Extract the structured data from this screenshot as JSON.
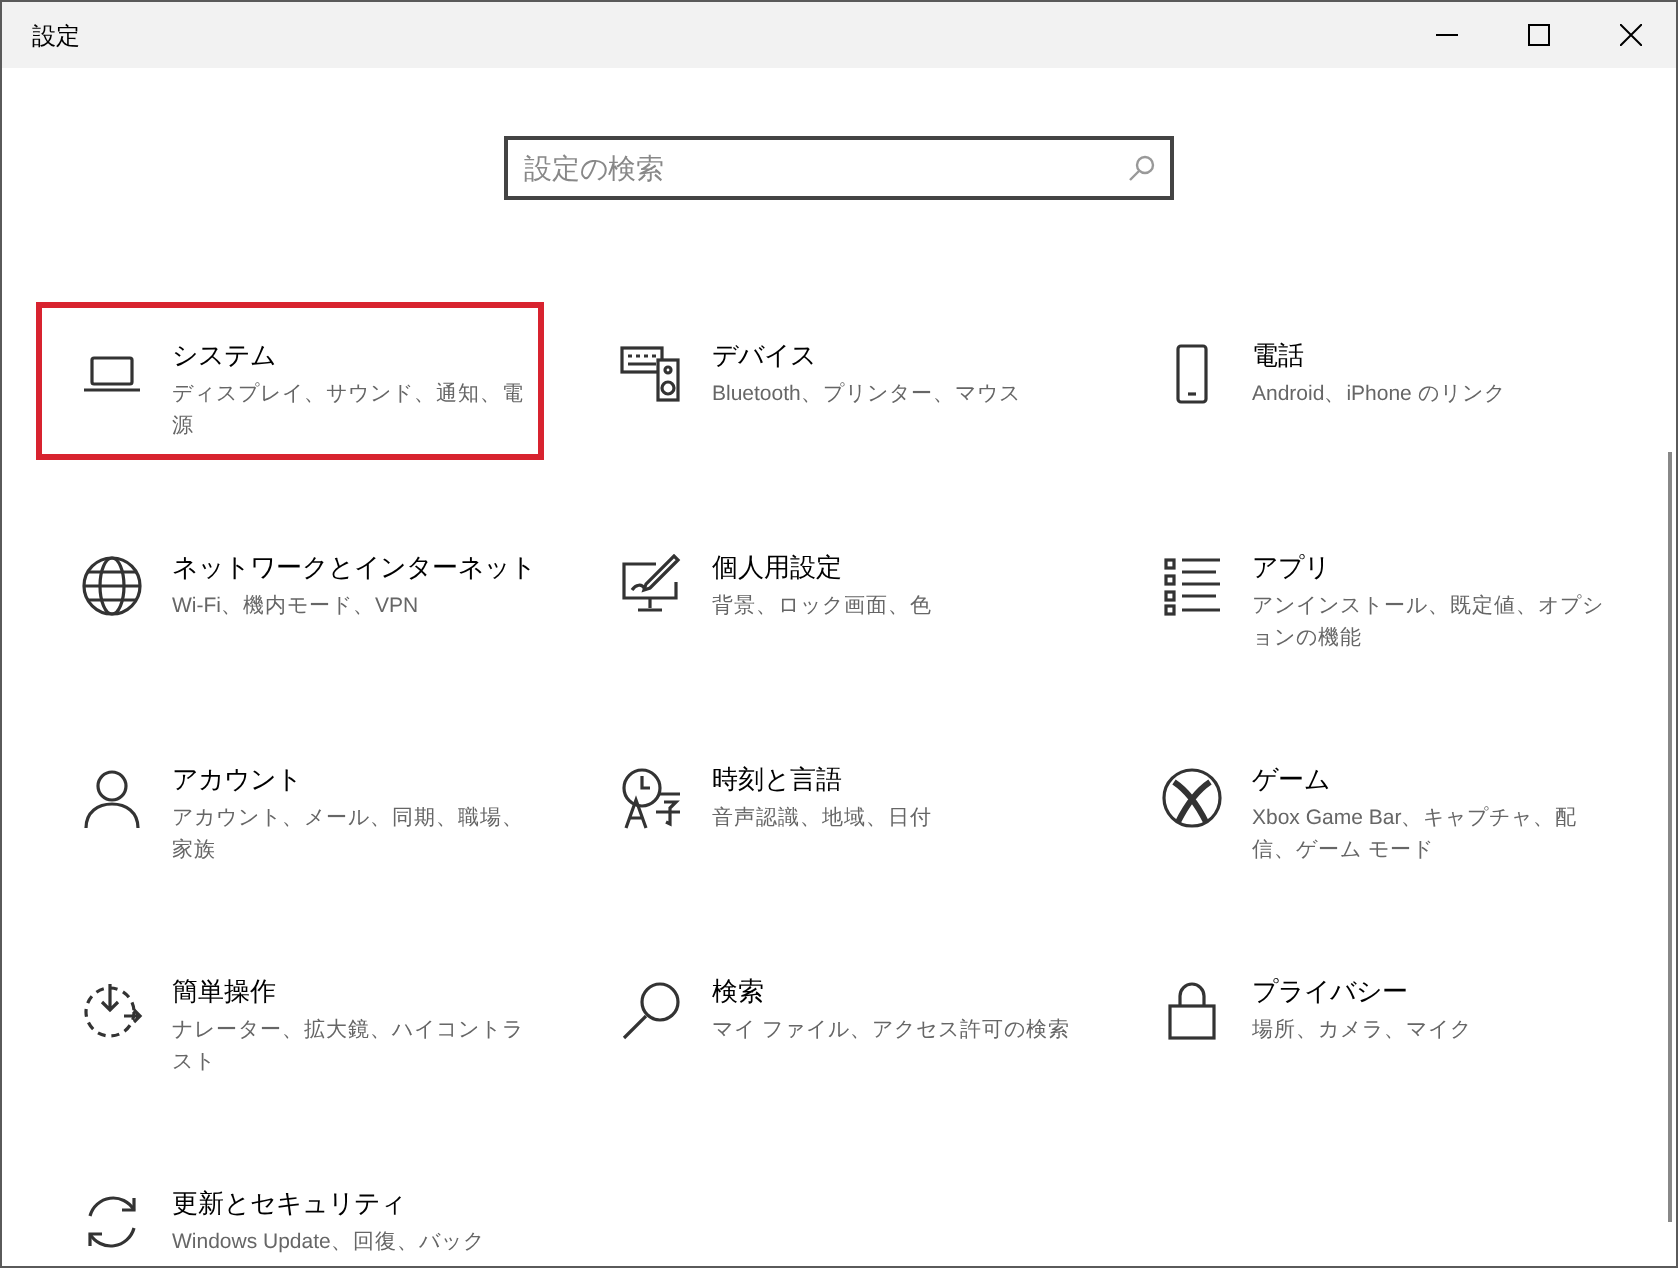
{
  "window": {
    "title": "設定"
  },
  "search": {
    "placeholder": "設定の検索"
  },
  "tiles": [
    {
      "title": "システム",
      "description": "ディスプレイ、サウンド、通知、電源",
      "selected": true
    },
    {
      "title": "デバイス",
      "description": "Bluetooth、プリンター、マウス",
      "selected": false
    },
    {
      "title": "電話",
      "description": "Android、iPhone のリンク",
      "selected": false
    },
    {
      "title": "ネットワークとインターネット",
      "description": "Wi-Fi、機内モード、VPN",
      "selected": false
    },
    {
      "title": "個人用設定",
      "description": "背景、ロック画面、色",
      "selected": false
    },
    {
      "title": "アプリ",
      "description": "アンインストール、既定値、オプションの機能",
      "selected": false
    },
    {
      "title": "アカウント",
      "description": "アカウント、メール、同期、職場、家族",
      "selected": false
    },
    {
      "title": "時刻と言語",
      "description": "音声認識、地域、日付",
      "selected": false
    },
    {
      "title": "ゲーム",
      "description": "Xbox Game Bar、キャプチャ、配信、ゲーム モード",
      "selected": false
    },
    {
      "title": "簡単操作",
      "description": "ナレーター、拡大鏡、ハイコントラスト",
      "selected": false
    },
    {
      "title": "検索",
      "description": "マイ ファイル、アクセス許可の検索",
      "selected": false
    },
    {
      "title": "プライバシー",
      "description": "場所、カメラ、マイク",
      "selected": false
    },
    {
      "title": "更新とセキュリティ",
      "description": "Windows Update、回復、バック",
      "selected": false
    }
  ]
}
